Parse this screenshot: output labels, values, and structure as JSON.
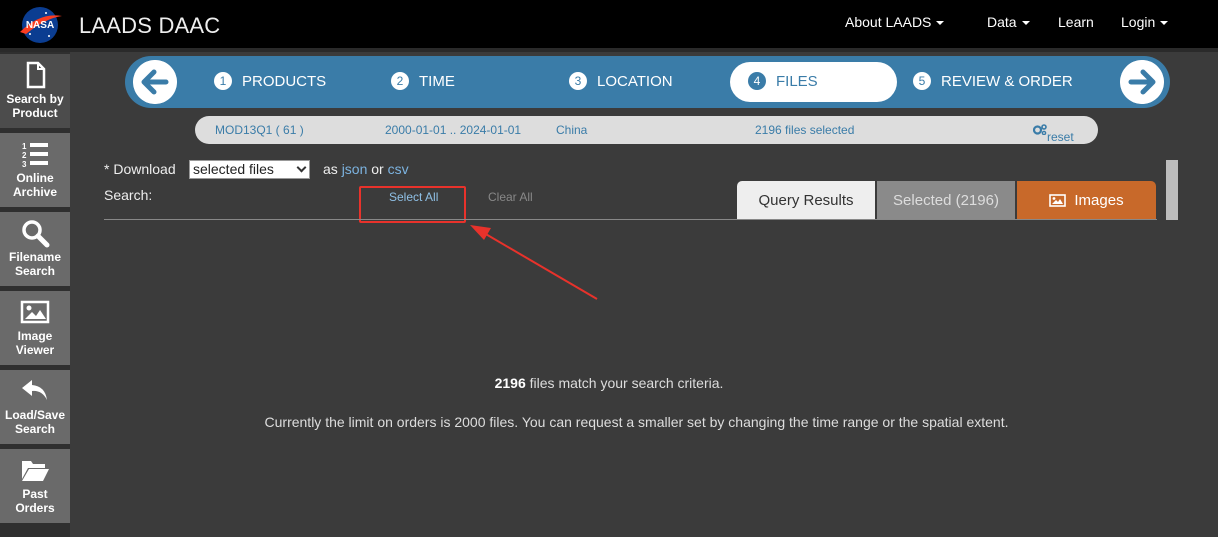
{
  "header": {
    "brand": "LAADS DAAC",
    "logo_text": "NASA",
    "nav": [
      {
        "label": "About LAADS",
        "dropdown": true
      },
      {
        "label": "Data",
        "dropdown": true
      },
      {
        "label": "Learn",
        "dropdown": false
      },
      {
        "label": "Login",
        "dropdown": true
      }
    ]
  },
  "sidebar": {
    "items": [
      {
        "label": "Search by Product",
        "icon": "file-icon",
        "active": true
      },
      {
        "label": "Online Archive",
        "icon": "list-icon",
        "active": false
      },
      {
        "label": "Filename Search",
        "icon": "search-icon",
        "active": false
      },
      {
        "label": "Image Viewer",
        "icon": "image-icon",
        "active": false
      },
      {
        "label": "Load/Save Search",
        "icon": "undo-icon",
        "active": false
      },
      {
        "label": "Past Orders",
        "icon": "folder-open-icon",
        "active": false
      }
    ]
  },
  "wizard": {
    "steps": [
      {
        "num": "1",
        "label": "PRODUCTS"
      },
      {
        "num": "2",
        "label": "TIME"
      },
      {
        "num": "3",
        "label": "LOCATION"
      },
      {
        "num": "4",
        "label": "FILES",
        "active": true
      },
      {
        "num": "5",
        "label": "REVIEW & ORDER"
      }
    ]
  },
  "summary": {
    "product": "MOD13Q1 ( 61 )",
    "date_range": "2000-01-01 .. 2024-01-01",
    "location": "China",
    "files_selected": "2196 files selected",
    "reset": "reset"
  },
  "download": {
    "prefix": "* Download",
    "select_value": "selected files",
    "as_text": "as",
    "json_link": "json",
    "or_text": "or",
    "csv_link": "csv"
  },
  "search": {
    "label": "Search:",
    "select_all": "Select All",
    "clear_all": "Clear All"
  },
  "tabs": {
    "query": "Query Results",
    "selected": "Selected (2196)",
    "images": "Images"
  },
  "results": {
    "count": "2196",
    "match_text": " files match your search criteria.",
    "limit_text": "Currently the limit on orders is 2000 files. You can request a smaller set by changing the time range or the spatial extent."
  },
  "colors": {
    "wizard_blue": "#3a7ca8",
    "images_tab": "#c8692a",
    "annotation_red": "#e8322b"
  }
}
